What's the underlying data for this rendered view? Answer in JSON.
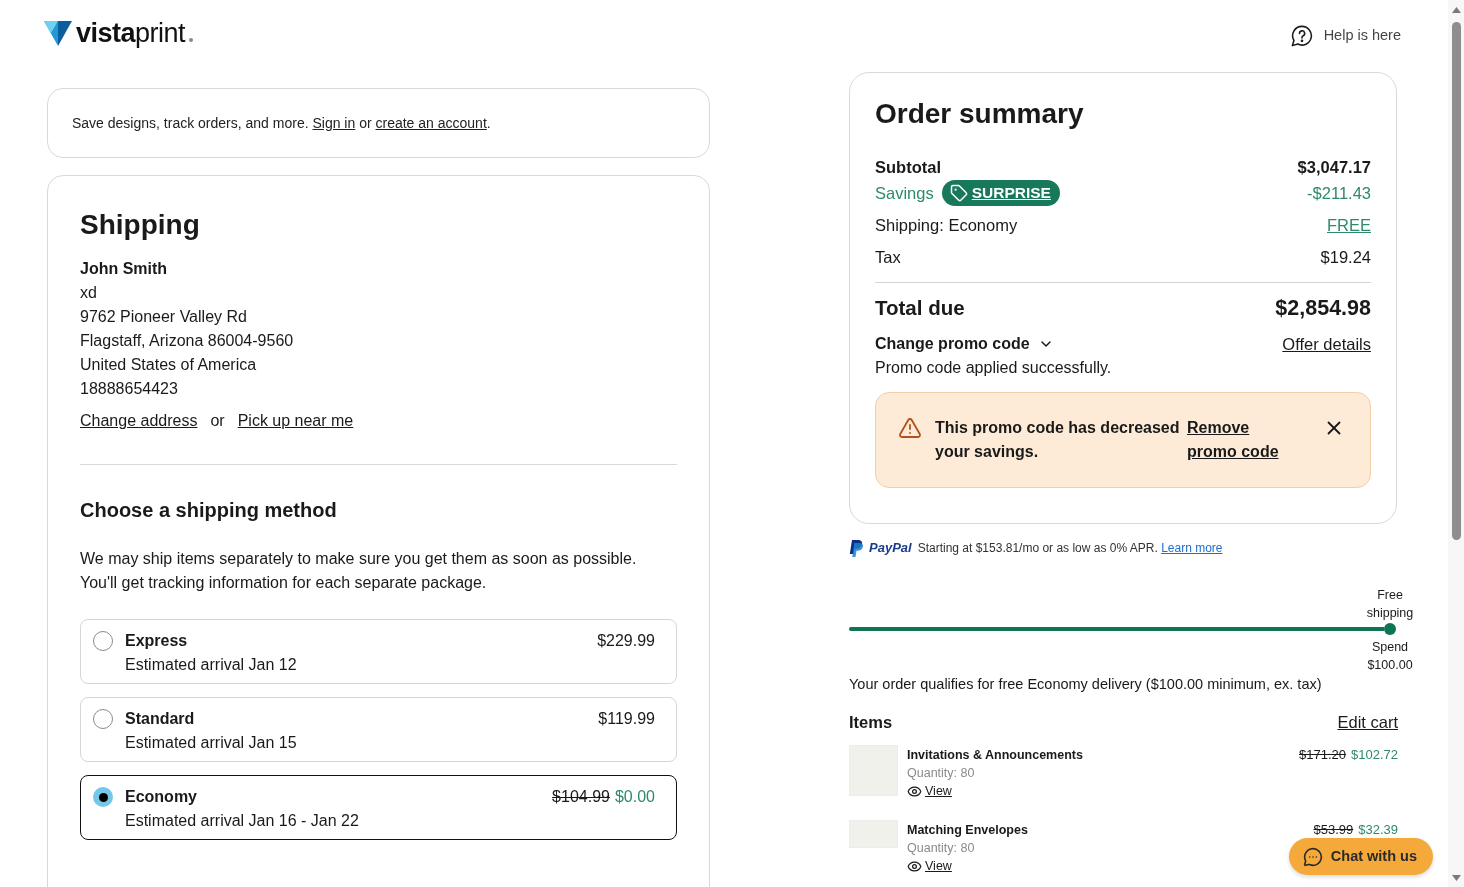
{
  "header": {
    "logo": "**vista**print",
    "help": "Help is here"
  },
  "sign_in": {
    "parts": [
      {
        "kind": "text",
        "text": "Save designs, track orders, and more. "
      },
      {
        "kind": "link",
        "text": "Sign in"
      },
      {
        "kind": "text",
        "text": " or "
      },
      {
        "kind": "link",
        "text": "create an account"
      },
      {
        "kind": "text",
        "text": "."
      }
    ]
  },
  "shipping": {
    "title": "Shipping",
    "address": {
      "name": "John Smith",
      "lines": [
        "xd",
        "9762 Pioneer Valley Rd",
        "Flagstaff, Arizona 86004-9560",
        "United States of America",
        "18888654423"
      ]
    },
    "address_actions": {
      "change": "Change address",
      "separator": "or",
      "pickup": "Pick up near me"
    },
    "method": {
      "title": "Choose a shipping method",
      "description": [
        "We may ship items separately to make sure you get them as soon as possible.",
        "You'll get tracking information for each separate package."
      ],
      "options": [
        {
          "name": "Express",
          "arrival": "Estimated arrival Jan 12",
          "price": "$229.99",
          "selected": false
        },
        {
          "name": "Standard",
          "arrival": "Estimated arrival Jan 15",
          "price": "$119.99",
          "selected": false
        },
        {
          "name": "Economy",
          "arrival": "Estimated arrival Jan 16 - Jan 22",
          "original_price": "$104.99",
          "price": "$0.00",
          "selected": true
        }
      ]
    }
  },
  "order_summary": {
    "title": "Order summary",
    "rows": [
      {
        "kind": "subtotal",
        "label": "Subtotal",
        "value": "$3,047.17"
      },
      {
        "kind": "savings",
        "label": "Savings",
        "promo_tag": "SURPRISE",
        "value": "-$211.43"
      },
      {
        "kind": "shipping",
        "label": "Shipping: Economy",
        "value": "FREE"
      },
      {
        "kind": "tax",
        "label": "Tax",
        "value": "$19.24"
      }
    ],
    "total": {
      "label": "Total due",
      "value": "$2,854.98"
    },
    "promo": {
      "toggle": "Change promo code",
      "expanded": false,
      "offer_link": "Offer details",
      "status": "Promo code applied successfully."
    },
    "alert": {
      "message": "This promo code has decreased your savings.",
      "action": "Remove promo code"
    }
  },
  "paypal": {
    "brand": "PayPal",
    "text": "Starting at $153.81/mo or as low as 0% APR.",
    "link": "Learn more"
  },
  "free_shipping": {
    "goal_label": "Free shipping",
    "spend_label": "Spend $100.00",
    "level": 1,
    "message": "Your order qualifies for free Economy delivery ($100.00 minimum, ex. tax)"
  },
  "items": {
    "title": "Items",
    "edit": "Edit cart",
    "list": [
      {
        "name": "Invitations & Announcements",
        "quantity": "Quantity: 80",
        "view": "View",
        "original_price": "$171.20",
        "price": "$102.72"
      },
      {
        "name": "Matching Envelopes",
        "quantity": "Quantity: 80",
        "view": "View",
        "original_price": "$53.99",
        "price": "$32.39"
      }
    ]
  },
  "chat": {
    "label": "Chat with us"
  }
}
